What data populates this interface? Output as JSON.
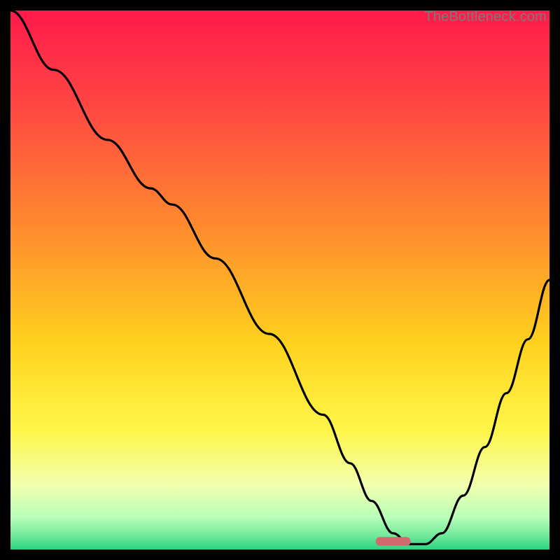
{
  "watermark": "TheBottleneck.com",
  "chart_data": {
    "type": "line",
    "title": "",
    "xlabel": "",
    "ylabel": "",
    "xlim": [
      0,
      100
    ],
    "ylim": [
      0,
      100
    ],
    "grid": false,
    "legend": false,
    "background_gradient_stops": [
      {
        "offset": 0.0,
        "color": "#ff1a4b"
      },
      {
        "offset": 0.18,
        "color": "#ff4742"
      },
      {
        "offset": 0.4,
        "color": "#ff8a2e"
      },
      {
        "offset": 0.62,
        "color": "#ffd21e"
      },
      {
        "offset": 0.78,
        "color": "#fff64a"
      },
      {
        "offset": 0.88,
        "color": "#f2ffae"
      },
      {
        "offset": 0.94,
        "color": "#b8ffb8"
      },
      {
        "offset": 0.975,
        "color": "#6fe89a"
      },
      {
        "offset": 1.0,
        "color": "#2bd582"
      }
    ],
    "curve": {
      "x": [
        0,
        8,
        18,
        26,
        30,
        38,
        48,
        58,
        63,
        67,
        71,
        74,
        77,
        80,
        84,
        88,
        92,
        96,
        100
      ],
      "y": [
        100,
        89,
        76,
        67,
        64,
        54,
        40,
        25,
        16,
        9,
        3,
        1,
        1,
        3,
        10,
        19,
        29,
        39,
        50
      ]
    },
    "marker": {
      "shape": "rounded-rect",
      "x": 71,
      "y": 1.5,
      "width_pct": 6.5,
      "height_pct": 1.6,
      "color": "#d16a6f"
    }
  }
}
